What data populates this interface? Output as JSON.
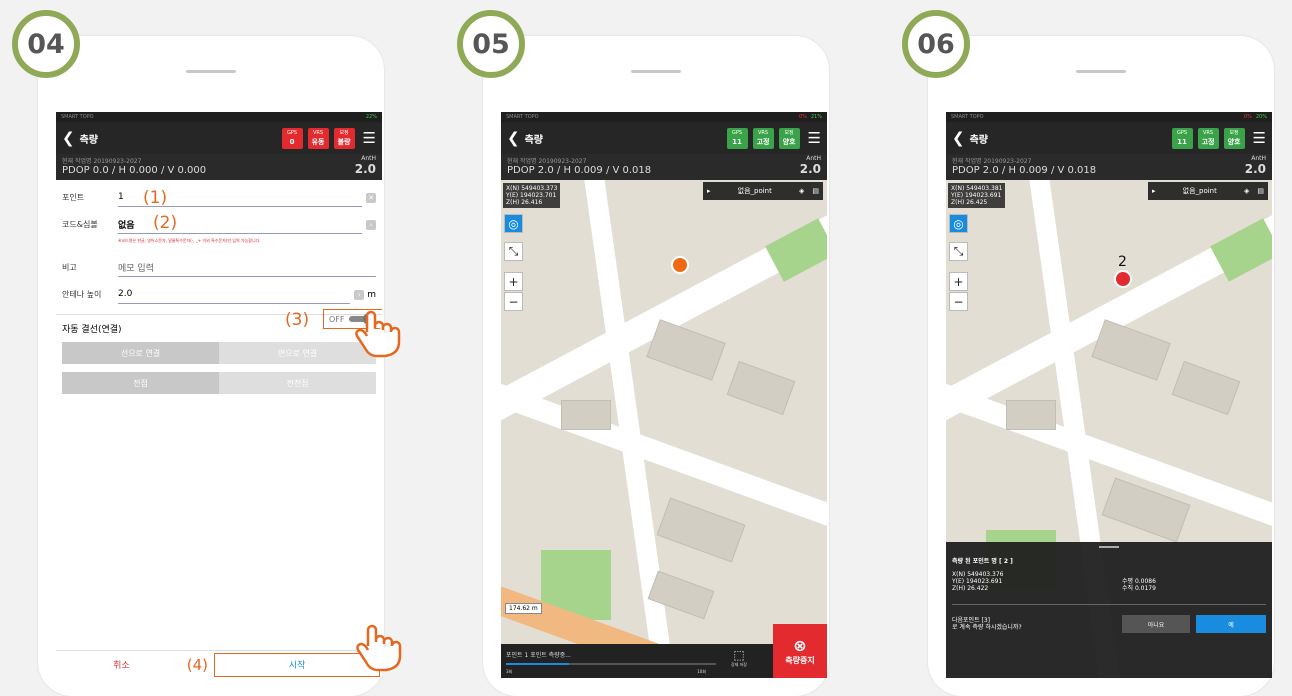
{
  "steps": [
    {
      "num": "04"
    },
    {
      "num": "05"
    },
    {
      "num": "06"
    }
  ],
  "status_app": "SMART TOPO",
  "p1": {
    "battery": "22%",
    "title": "측량",
    "gps_label": "GPS",
    "gps_val": "0",
    "vrs_label": "VRS",
    "vrs_val": "유동",
    "bo_label": "보정",
    "bo_val": "불량",
    "job_label": "현재 작업명",
    "job": "20190923-2027",
    "pdop": "PDOP 0.0 / H 0.000 / V 0.000",
    "anth_label": "AntH",
    "anth": "2.0",
    "point_label": "포인트",
    "point_val": "1",
    "code_label": "코드&심볼",
    "code_val": "없음",
    "code_hint": "※코드명은 한글, 영어소문자, 밑줄특수문자(-, _+ 이외 특수문자)만 입력 가능합니다.",
    "memo_label": "비고",
    "memo_placeholder": "메모 입력",
    "ant_label": "안테나 높이",
    "ant_val": "2.0",
    "ant_unit": "m",
    "auto_label": "자동 결선(연결)",
    "toggle": "OFF",
    "seg1a": "선으로 연결",
    "seg1b": "면으로 연결",
    "seg2a": "전점",
    "seg2b": "전전점",
    "cancel": "취소",
    "start": "시작",
    "a1": "(1)",
    "a2": "(2)",
    "a3": "(3)",
    "a4": "(4)"
  },
  "p2": {
    "bat_low": "0%",
    "battery": "21%",
    "title": "측량",
    "gps_val": "11",
    "vrs_val": "고정",
    "bo_val": "양호",
    "job": "20190923-2027",
    "pdop": "PDOP 2.0 / H 0.009 / V 0.018",
    "anth": "2.0",
    "coord": [
      "X(N) 549403.373",
      "Y(E) 194023.701",
      "Z(H) 26.416"
    ],
    "layer": "없음_point",
    "scale": "174.62 m",
    "meas": "포인트 1 포인트 측량중...",
    "prog_l": "3회",
    "prog_r": "10회",
    "save": "강제 저장",
    "stop": "측량중지"
  },
  "p3": {
    "bat_low": "0%",
    "battery": "20%",
    "title": "측량",
    "gps_val": "11",
    "vrs_val": "고정",
    "bo_val": "양호",
    "job": "20190923-2027",
    "pdop": "PDOP 2.0 / H 0.009 / V 0.018",
    "anth": "2.0",
    "coord": [
      "X(N) 549403.381",
      "Y(E) 194023.691",
      "Z(H) 26.425"
    ],
    "layer": "없음_point",
    "marker": "2",
    "res_title": "측량 된 포인트 명 [ 2 ]",
    "res_coord": [
      "X(N) 549403.376",
      "Y(E) 194023.691",
      "Z(H) 26.422"
    ],
    "h": "수평 0.0086",
    "v": "수직 0.0179",
    "next": "다음포인트 [3]",
    "q": "로 계속 측량 하시겠습니까?",
    "no": "아니요",
    "yes": "예"
  },
  "colors": {
    "badge": "#8fa956",
    "annot": "#e56820",
    "red": "#e22a2f",
    "green": "#3aa34a",
    "blue": "#1a8ce0"
  }
}
